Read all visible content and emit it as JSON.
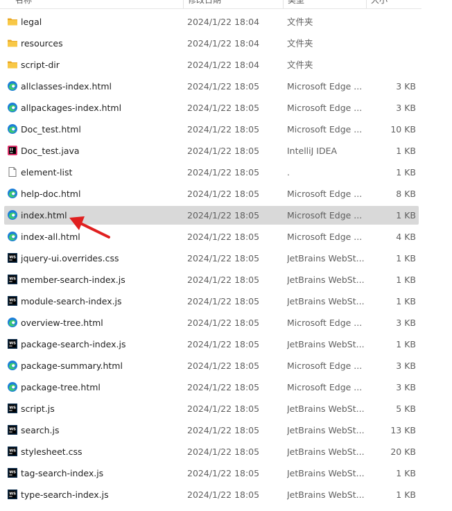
{
  "header": {
    "name": "名称",
    "date": "修改日期",
    "type": "类型",
    "size": "大小"
  },
  "files": [
    {
      "name": "legal",
      "date": "2024/1/22 18:04",
      "type": "文件夹",
      "size": "",
      "icon": "folder-icon"
    },
    {
      "name": "resources",
      "date": "2024/1/22 18:04",
      "type": "文件夹",
      "size": "",
      "icon": "folder-icon"
    },
    {
      "name": "script-dir",
      "date": "2024/1/22 18:04",
      "type": "文件夹",
      "size": "",
      "icon": "folder-icon"
    },
    {
      "name": "allclasses-index.html",
      "date": "2024/1/22 18:05",
      "type": "Microsoft Edge ...",
      "size": "3 KB",
      "icon": "edge-icon"
    },
    {
      "name": "allpackages-index.html",
      "date": "2024/1/22 18:05",
      "type": "Microsoft Edge ...",
      "size": "3 KB",
      "icon": "edge-icon"
    },
    {
      "name": "Doc_test.html",
      "date": "2024/1/22 18:05",
      "type": "Microsoft Edge ...",
      "size": "10 KB",
      "icon": "edge-icon"
    },
    {
      "name": "Doc_test.java",
      "date": "2024/1/22 18:05",
      "type": "IntelliJ IDEA",
      "size": "1 KB",
      "icon": "intellij-icon"
    },
    {
      "name": "element-list",
      "date": "2024/1/22 18:05",
      "type": ".",
      "size": "1 KB",
      "icon": "file-icon"
    },
    {
      "name": "help-doc.html",
      "date": "2024/1/22 18:05",
      "type": "Microsoft Edge ...",
      "size": "8 KB",
      "icon": "edge-icon"
    },
    {
      "name": "index.html",
      "date": "2024/1/22 18:05",
      "type": "Microsoft Edge ...",
      "size": "1 KB",
      "icon": "edge-icon",
      "selected": true
    },
    {
      "name": "index-all.html",
      "date": "2024/1/22 18:05",
      "type": "Microsoft Edge ...",
      "size": "4 KB",
      "icon": "edge-icon"
    },
    {
      "name": "jquery-ui.overrides.css",
      "date": "2024/1/22 18:05",
      "type": "JetBrains WebSt...",
      "size": "1 KB",
      "icon": "webstorm-icon"
    },
    {
      "name": "member-search-index.js",
      "date": "2024/1/22 18:05",
      "type": "JetBrains WebSt...",
      "size": "1 KB",
      "icon": "webstorm-icon"
    },
    {
      "name": "module-search-index.js",
      "date": "2024/1/22 18:05",
      "type": "JetBrains WebSt...",
      "size": "1 KB",
      "icon": "webstorm-icon"
    },
    {
      "name": "overview-tree.html",
      "date": "2024/1/22 18:05",
      "type": "Microsoft Edge ...",
      "size": "3 KB",
      "icon": "edge-icon"
    },
    {
      "name": "package-search-index.js",
      "date": "2024/1/22 18:05",
      "type": "JetBrains WebSt...",
      "size": "1 KB",
      "icon": "webstorm-icon"
    },
    {
      "name": "package-summary.html",
      "date": "2024/1/22 18:05",
      "type": "Microsoft Edge ...",
      "size": "3 KB",
      "icon": "edge-icon"
    },
    {
      "name": "package-tree.html",
      "date": "2024/1/22 18:05",
      "type": "Microsoft Edge ...",
      "size": "3 KB",
      "icon": "edge-icon"
    },
    {
      "name": "script.js",
      "date": "2024/1/22 18:05",
      "type": "JetBrains WebSt...",
      "size": "5 KB",
      "icon": "webstorm-icon"
    },
    {
      "name": "search.js",
      "date": "2024/1/22 18:05",
      "type": "JetBrains WebSt...",
      "size": "13 KB",
      "icon": "webstorm-icon"
    },
    {
      "name": "stylesheet.css",
      "date": "2024/1/22 18:05",
      "type": "JetBrains WebSt...",
      "size": "20 KB",
      "icon": "webstorm-icon"
    },
    {
      "name": "tag-search-index.js",
      "date": "2024/1/22 18:05",
      "type": "JetBrains WebSt...",
      "size": "1 KB",
      "icon": "webstorm-icon"
    },
    {
      "name": "type-search-index.js",
      "date": "2024/1/22 18:05",
      "type": "JetBrains WebSt...",
      "size": "1 KB",
      "icon": "webstorm-icon"
    }
  ],
  "annotation": {
    "icon": "red-arrow-icon",
    "color": "#e02020",
    "points_to": "index.html"
  },
  "colors": {
    "selected_row": "#d9d9d9",
    "folder": "#f4c542",
    "edge": "#1e88e5"
  }
}
